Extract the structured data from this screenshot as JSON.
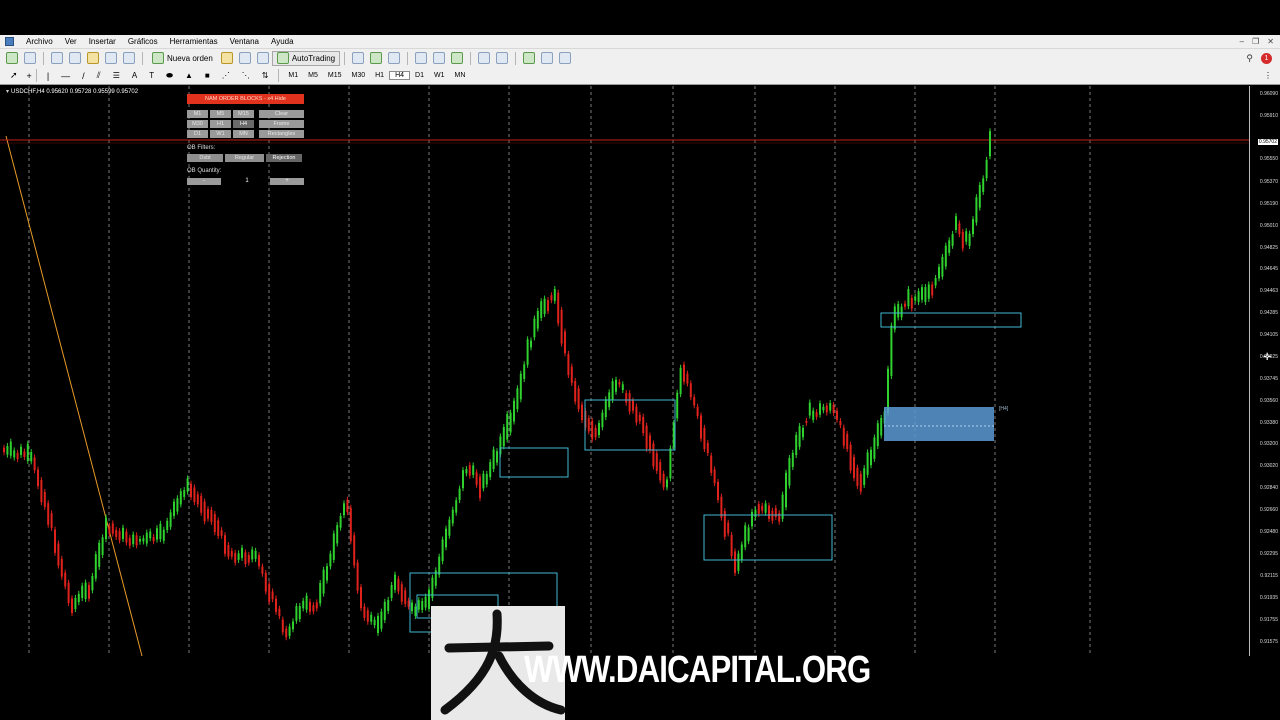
{
  "menu": {
    "items": [
      "Archivo",
      "Ver",
      "Insertar",
      "Gráficos",
      "Herramientas",
      "Ventana",
      "Ayuda"
    ]
  },
  "toolbar": {
    "new_order_label": "Nueva orden",
    "autotrading_label": "AutoTrading",
    "timeframes": [
      "M1",
      "M5",
      "M15",
      "M30",
      "H1",
      "H4",
      "D1",
      "W1",
      "MN"
    ],
    "active_timeframe": "H4"
  },
  "chart": {
    "symbol_info": "USDCHF,H4  0.95620 0.95728 0.95599 0.95702",
    "current_price": "0.95702",
    "price_labels": [
      "0.96090",
      "0.95910",
      "0.95702",
      "0.95550",
      "0.95370",
      "0.95190",
      "0.95010",
      "0.94825",
      "0.94645",
      "0.94463",
      "0.94285",
      "0.94105",
      "0.93925",
      "0.93745",
      "0.93560",
      "0.93380",
      "0.93200",
      "0.93020",
      "0.92840",
      "0.92660",
      "0.92480",
      "0.92295",
      "0.92115",
      "0.91935",
      "0.91755",
      "0.91575"
    ],
    "zone_label": "[H4]",
    "colors": {
      "bull": "#2fd12f",
      "bear": "#e0221c",
      "zone_outline": "#3fb9d3",
      "zone_fill": "#5b9bd5",
      "trendline": "#e89a28",
      "price_line": "#c0201a",
      "grid": "#7a7a7a"
    }
  },
  "ob_panel": {
    "title": "NAM ORDER BLOCKS - x4 Hide",
    "timeframe_buttons": [
      "M1",
      "M5",
      "M15",
      "M30",
      "H1",
      "H4",
      "D1",
      "W1",
      "MN"
    ],
    "clear_label": "Clear",
    "frame_label": "Frame",
    "rectangles_label": "Rectangles",
    "filters_label": "OB Filters:",
    "filter_buttons": [
      "Dsbt",
      "Regular",
      "Rejection"
    ],
    "quantity_label": "OB Quantity:",
    "minus_label": "-",
    "quantity_value": "1",
    "plus_label": "+"
  },
  "watermark": {
    "text": "WWW.DAICAPITAL.ORG"
  }
}
